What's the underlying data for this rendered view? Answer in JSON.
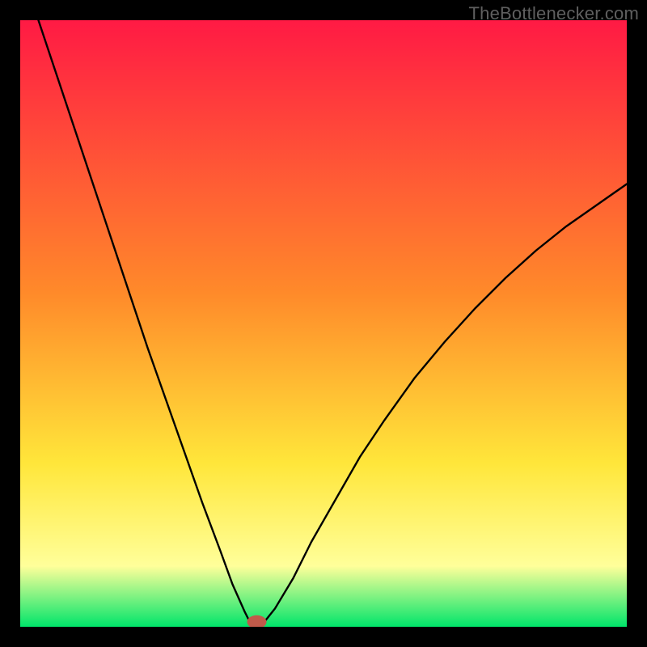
{
  "watermark": "TheBottlenecker.com",
  "chart_data": {
    "type": "line",
    "title": "",
    "xlabel": "",
    "ylabel": "",
    "xlim": [
      0,
      100
    ],
    "ylim": [
      0,
      100
    ],
    "grid": false,
    "gradient": {
      "top": "#ff1a44",
      "mid1": "#ff8a2a",
      "mid2": "#ffe63a",
      "mid3": "#ffff9a",
      "bottom": "#00e56a"
    },
    "series": [
      {
        "name": "curve-left",
        "x": [
          3,
          6,
          9,
          12,
          15,
          18,
          21,
          24,
          27,
          30,
          33,
          35,
          37,
          38
        ],
        "y": [
          100,
          91,
          82,
          73,
          64,
          55,
          46,
          37.5,
          29,
          20.5,
          12.5,
          7,
          2.5,
          0.5
        ]
      },
      {
        "name": "curve-right",
        "x": [
          40,
          42,
          45,
          48,
          52,
          56,
          60,
          65,
          70,
          75,
          80,
          85,
          90,
          95,
          100
        ],
        "y": [
          0.5,
          3,
          8,
          14,
          21,
          28,
          34,
          41,
          47,
          52.5,
          57.5,
          62,
          66,
          69.5,
          73
        ]
      }
    ],
    "marker": {
      "x": 39,
      "y": 0.8,
      "rx": 1.6,
      "ry": 1.1,
      "color": "#c05a4a"
    }
  }
}
